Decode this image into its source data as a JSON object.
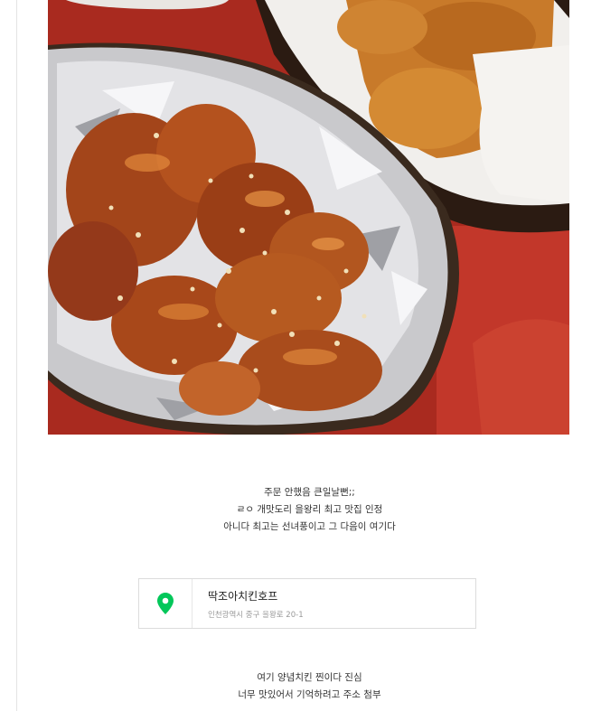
{
  "photo": {
    "icon": "food-photo-chicken"
  },
  "caption_first": {
    "lines": [
      "주문 안했음 큰일날뻔;;",
      "ㄹㅇ 개맛도리 을왕리 최고 맛집 인정",
      "아니다 최고는 선녀풍이고 그 다음이 여기다"
    ]
  },
  "place": {
    "icon": "map-pin-icon",
    "icon_color": "#03c75a",
    "name": "딱조아치킨호프",
    "address": "인천광역시 중구 을왕로 20-1"
  },
  "caption_second": {
    "lines": [
      "여기 양념치킨 찐이다 진심",
      "너무 맛있어서 기억하려고 주소 첨부"
    ]
  }
}
